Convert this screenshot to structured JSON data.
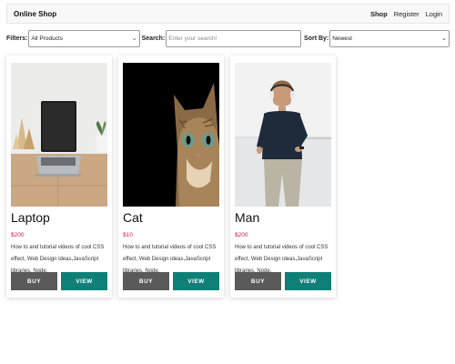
{
  "navbar": {
    "brand": "Online Shop",
    "links": [
      {
        "label": "Shop"
      },
      {
        "label": "Register"
      },
      {
        "label": "Login"
      }
    ]
  },
  "filters": {
    "filters_label": "Filters:",
    "filters_value": "All Products",
    "search_label": "Search:",
    "search_placeholder": "Enter your search!",
    "sort_label": "Sort By:",
    "sort_value": "Newest"
  },
  "products": [
    {
      "title": "Laptop",
      "price": "$200",
      "description": "How to and tutorial videos of cool CSS effect, Web Design ideas,JavaScript libraries, Node.",
      "buy_label": "BUY",
      "view_label": "VIEW"
    },
    {
      "title": "Cat",
      "price": "$10",
      "description": "How to and tutorial videos of cool CSS effect, Web Design ideas,JavaScript libraries, Node.",
      "buy_label": "BUY",
      "view_label": "VIEW"
    },
    {
      "title": "Man",
      "price": "$200",
      "description": "How to and tutorial videos of cool CSS effect, Web Design ideas,JavaScript libraries, Node.",
      "buy_label": "BUY",
      "view_label": "VIEW"
    }
  ],
  "colors": {
    "price": "#c2185b",
    "buy_button": "#5a5a5a",
    "view_button": "#0f8078"
  }
}
